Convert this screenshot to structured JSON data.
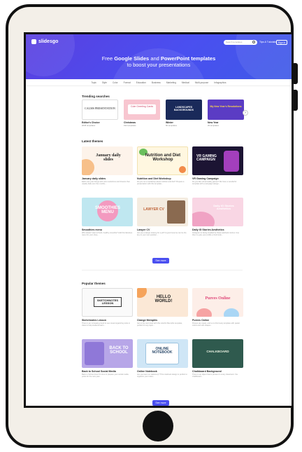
{
  "brand": {
    "name": "slidesgo"
  },
  "header": {
    "search_placeholder": "Search templates",
    "for_editors": "Tips & Tutorials",
    "signin": "Sign in",
    "title_pre": "Free ",
    "title_bold1": "Google Slides",
    "title_mid": " and ",
    "title_bold2": "PowerPoint templates",
    "title_line2": "to boost your presentations"
  },
  "nav": [
    "Topic",
    "Style",
    "Color",
    "Format",
    "Education",
    "Business",
    "Marketing",
    "Medical",
    "Multi-purpose",
    "Infographics"
  ],
  "trending": {
    "title": "Trending searches",
    "items": [
      {
        "label": "Editor's Choice",
        "sub": "2645 templates",
        "thumb_text": "CALMS PRESENTATION"
      },
      {
        "label": "Christmas",
        "sub": "192 templates",
        "thumb_text": "Cute Greeting Cards"
      },
      {
        "label": "Winter",
        "sub": "60 templates",
        "thumb_text": "LANDSCAPES BACKGROUNDS"
      },
      {
        "label": "New Year",
        "sub": "29 templates",
        "thumb_text": "My New Year's Resolutions"
      }
    ]
  },
  "latest": {
    "title": "Latest themes",
    "items": [
      {
        "title": "January daily slides",
        "desc": "Each new year brings with new resolutions and dreams that usually fade over the months...",
        "thumb_text": "January daily slides"
      },
      {
        "title": "Nutrition and Diet Workshop",
        "desc": "Do you run a workshop about nutrition and diet? Prepare a presentation with this template...",
        "thumb_text": "Nutrition and Diet Workshop"
      },
      {
        "title": "VR Gaming Campaign",
        "desc": "Do you like virtual reality games? We have a wonderful template with a campaign design...",
        "thumb_text": "VR GAMING CAMPAIGN"
      },
      {
        "title": "Smoothies menu",
        "desc": "Who doesn't want a fresh, healthy smoothie? Add this fabulous menu for your shop...",
        "thumb_text": "SMOOTHIES MENU"
      },
      {
        "title": "Lawyer CV",
        "desc": "Are you a lawyer looking for a job? A good resume can be the key to your next position...",
        "thumb_text": "LAWYER CV"
      },
      {
        "title": "Daily IG Stories Aesthetics",
        "desc": "Instagram is being invaded by these aesthetic stories. Use them to give your profile a fresh look...",
        "thumb_text": "Daily IG Stories Aesthetics"
      }
    ],
    "see_more": "See more"
  },
  "popular": {
    "title": "Popular themes",
    "items": [
      {
        "title": "Sketchnotes Lesson",
        "desc": "There is an increasing trend to use visual organizing tools in class to help students learn...",
        "thumb_text": "SKETCHNOTES LESSON"
      },
      {
        "title": "Orange Memphis",
        "desc": "Get to the next level with this colorful Memphis template, perfect for any topic...",
        "thumb_text": "HELLO WORLD!"
      },
      {
        "title": "Purees Online",
        "desc": "Purees are sweet, and so is this lovely template with pastel colors and soft shapes...",
        "thumb_text": "Purees Online"
      },
      {
        "title": "Back to School Social Media",
        "desc": "Back to School time! It's time to prepare your social media posts for the new year...",
        "thumb_text": "BACK TO SCHOOL"
      },
      {
        "title": "Online Notebook",
        "desc": "Are you keen on stationery? This notebook design is perfect to organize your notes...",
        "thumb_text": "ONLINE NOTEBOOK"
      },
      {
        "title": "Chalkboard Background",
        "desc": "There is an object that is present in every classroom: the chalkboard...",
        "thumb_text": "CHALKBOARD"
      }
    ],
    "see_more": "See more"
  }
}
